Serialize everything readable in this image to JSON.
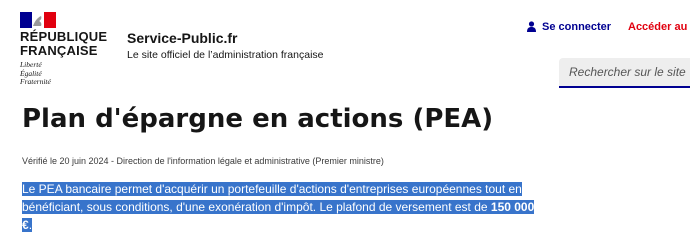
{
  "header": {
    "republic_name": "République\nFrançaise",
    "motto": "Liberté\nÉgalité\nFraternité",
    "service_name": "Service-Public.fr",
    "service_tagline": "Le site officiel de l’administration française",
    "connect_label": "Se connecter",
    "access_label": "Accéder au sit",
    "search_placeholder": "Rechercher sur le site",
    "icons": {
      "connect": "user-icon",
      "logo": "marianne-logo"
    },
    "colors": {
      "blue": "#000091",
      "red": "#e1000f",
      "highlight": "#3874cb"
    }
  },
  "article": {
    "title": "Plan d'épargne en actions (PEA)",
    "verified": "Vérifié le 20 juin 2024 - Direction de l'information légale et administrative (Premier ministre)",
    "intro_text": "Le PEA bancaire permet d'acquérir un portefeuille d'actions d'entreprises européennes tout en bénéficiant, sous conditions, d'une exonération d'impôt. Le plafond de versement est de ",
    "intro_amount": "150 000 €",
    "intro_end": "."
  }
}
